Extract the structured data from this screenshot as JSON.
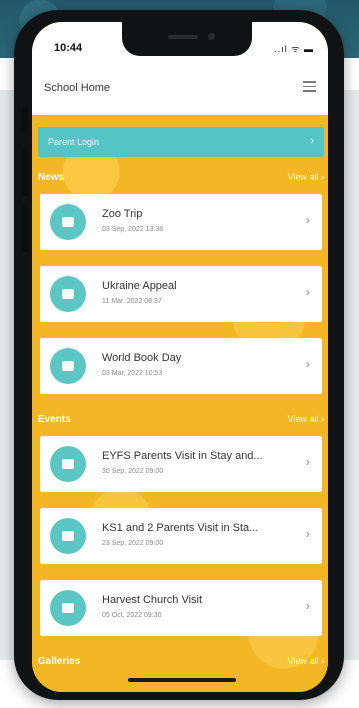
{
  "status": {
    "time": "10:44",
    "icons": "..ıl ᯤ ▬"
  },
  "appbar": {
    "title": "School Home"
  },
  "login": {
    "label": "Parent Login",
    "chevron": "›"
  },
  "news": {
    "title": "News",
    "view_all": "View all ›",
    "items": [
      {
        "title": "Zoo Trip",
        "date": "03 Sep, 2022 13:38"
      },
      {
        "title": "Ukraine Appeal",
        "date": "11 Mar, 2022 08:37"
      },
      {
        "title": "World Book Day",
        "date": "03 Mar, 2022 10:53"
      }
    ]
  },
  "events": {
    "title": "Events",
    "view_all": "View all ›",
    "items": [
      {
        "title": "EYFS Parents Visit in Stay and...",
        "date": "30 Sep, 2022 09:00"
      },
      {
        "title": "KS1 and 2 Parents Visit in Sta...",
        "date": "23 Sep, 2022 09:00"
      },
      {
        "title": "Harvest Church Visit",
        "date": "05 Oct, 2022 09:30"
      }
    ]
  },
  "galleries": {
    "title": "Galleries",
    "view_all": "View all ›"
  },
  "chevron": "›"
}
